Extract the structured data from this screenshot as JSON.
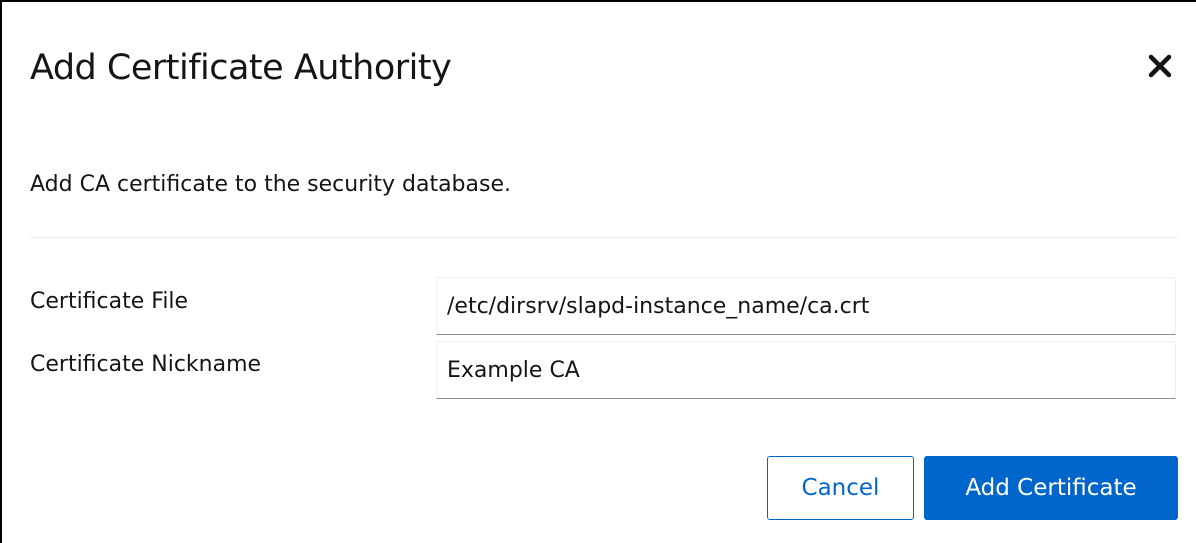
{
  "dialog": {
    "title": "Add Certificate Authority",
    "close_icon": "close-icon",
    "description": "Add CA certificate to the security database.",
    "form": {
      "file_label": "Certificate File",
      "file_value": "/etc/dirsrv/slapd-instance_name/ca.crt",
      "nickname_label": "Certificate Nickname",
      "nickname_value": "Example CA"
    },
    "actions": {
      "cancel_label": "Cancel",
      "add_label": "Add Certificate"
    }
  },
  "colors": {
    "primary": "#0066cc",
    "text": "#151515",
    "divider": "#ececec"
  }
}
